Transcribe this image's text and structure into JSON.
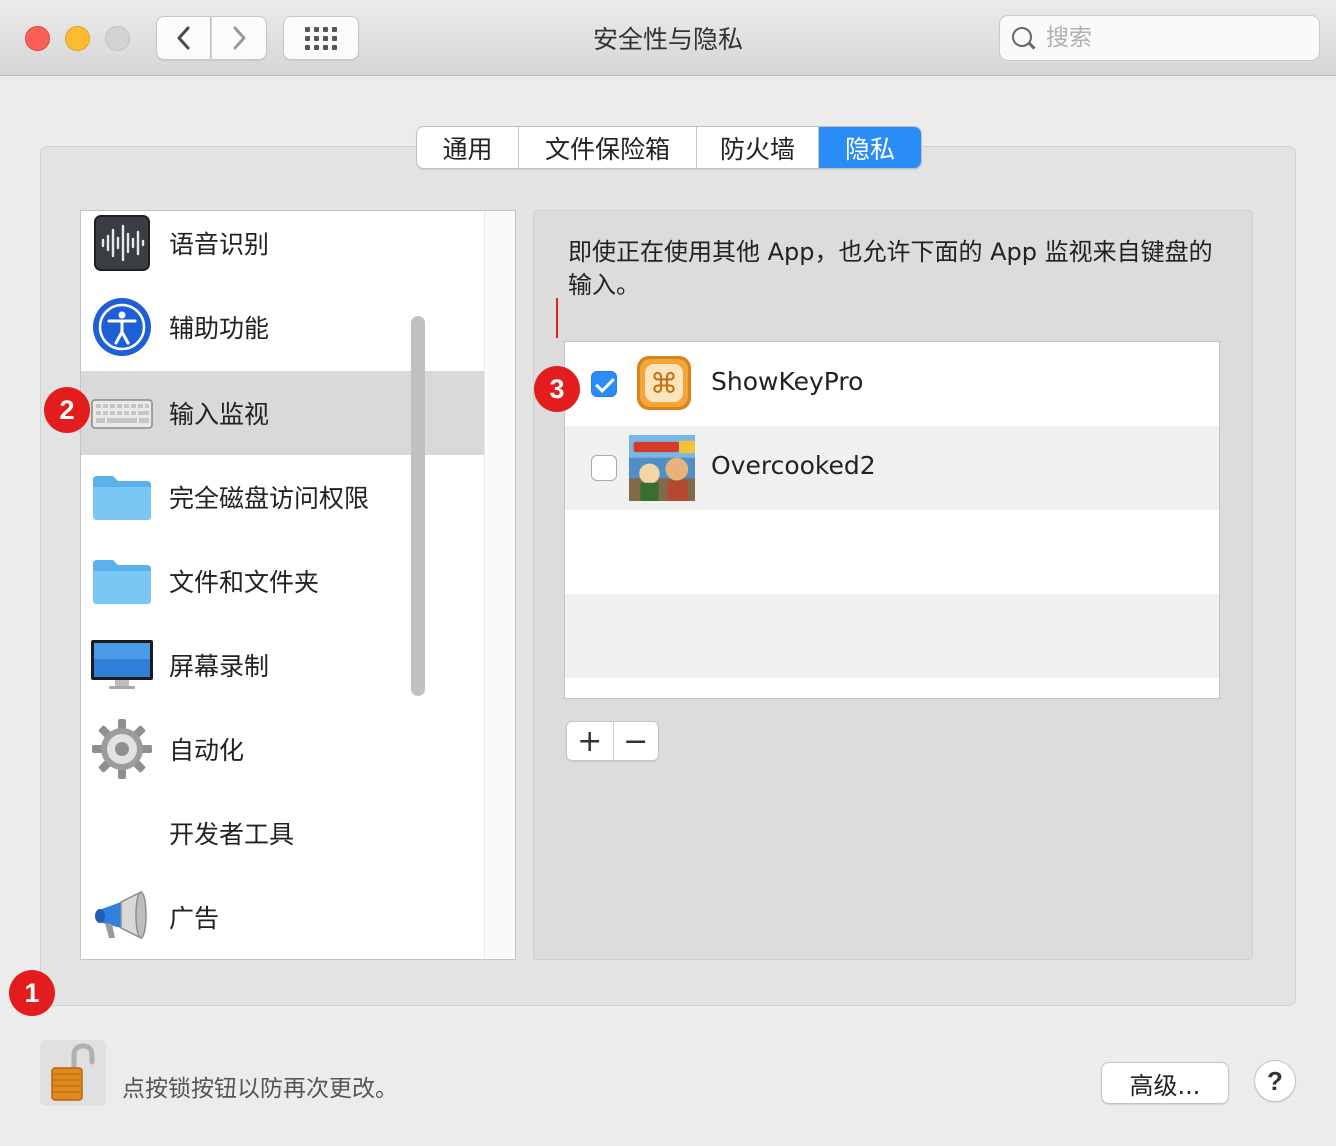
{
  "window": {
    "title": "安全性与隐私",
    "search_placeholder": "搜索"
  },
  "toolbar": {
    "back_icon": "chevron-left-icon",
    "forward_icon": "chevron-right-icon",
    "grid_icon": "show-all-grid-icon"
  },
  "tabs": [
    {
      "label": "通用",
      "active": false
    },
    {
      "label": "文件保险箱",
      "active": false
    },
    {
      "label": "防火墙",
      "active": false
    },
    {
      "label": "隐私",
      "active": true
    }
  ],
  "categories": [
    {
      "label": "语音识别",
      "icon": "speech-waveform-icon",
      "selected": false
    },
    {
      "label": "辅助功能",
      "icon": "accessibility-icon",
      "selected": false
    },
    {
      "label": "输入监视",
      "icon": "keyboard-icon",
      "selected": true
    },
    {
      "label": "完全磁盘访问权限",
      "icon": "folder-icon",
      "selected": false
    },
    {
      "label": "文件和文件夹",
      "icon": "folder-icon",
      "selected": false
    },
    {
      "label": "屏幕录制",
      "icon": "monitor-icon",
      "selected": false
    },
    {
      "label": "自动化",
      "icon": "gear-icon",
      "selected": false
    },
    {
      "label": "开发者工具",
      "icon": "",
      "selected": false
    },
    {
      "label": "广告",
      "icon": "megaphone-icon",
      "selected": false
    }
  ],
  "detail": {
    "description": "即使正在使用其他 App，也允许下面的 App 监视来自键盘的输入。",
    "apps": [
      {
        "name": "ShowKeyPro",
        "checked": true,
        "icon": "showkeypro-app-icon"
      },
      {
        "name": "Overcooked2",
        "checked": false,
        "icon": "overcooked2-app-icon"
      }
    ],
    "add_label": "+",
    "remove_label": "−"
  },
  "badges": [
    "1",
    "2",
    "3"
  ],
  "footer": {
    "lock_text": "点按锁按钮以防再次更改。",
    "advanced_label": "高级...",
    "help_label": "?"
  },
  "colors": {
    "accent": "#2a8cf7",
    "badge": "#e31d1d"
  }
}
